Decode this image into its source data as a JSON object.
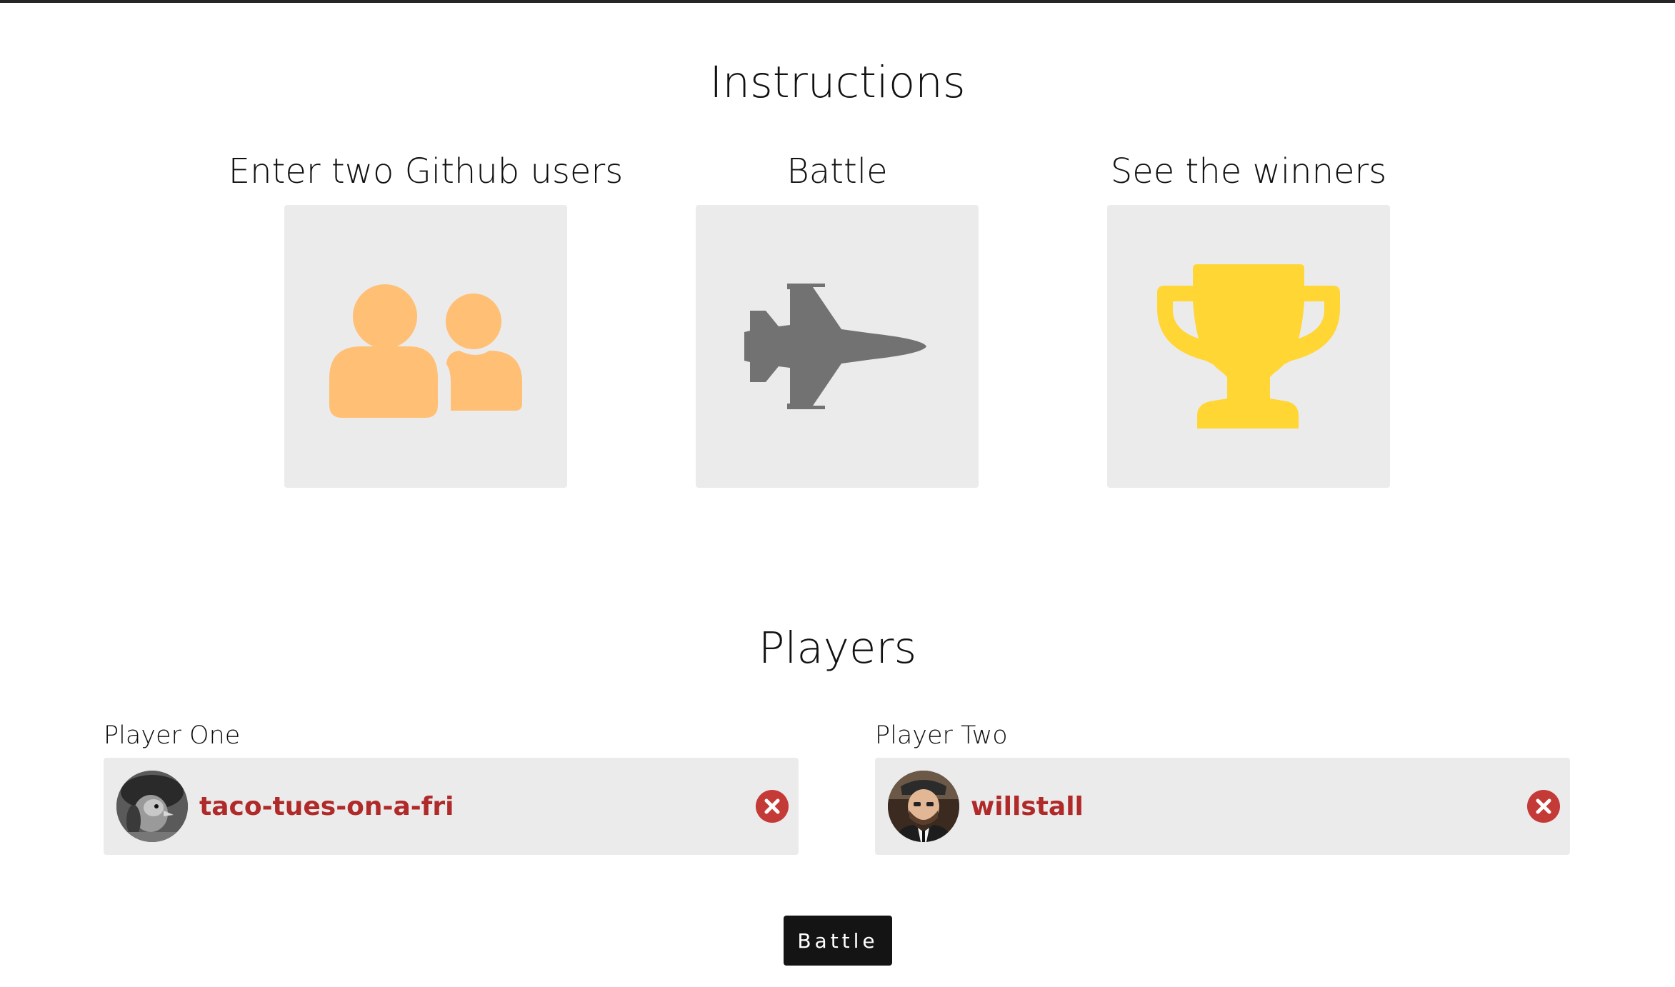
{
  "instructions": {
    "title": "Instructions",
    "steps": [
      {
        "label": "Enter two Github users",
        "icon": "users-icon",
        "color": "#ffbf74"
      },
      {
        "label": "Battle",
        "icon": "fighter-jet-icon",
        "color": "#727272"
      },
      {
        "label": "See the winners",
        "icon": "trophy-icon",
        "color": "#ffd633"
      }
    ]
  },
  "players": {
    "title": "Players",
    "one": {
      "label": "Player One",
      "username": "taco-tues-on-a-fri"
    },
    "two": {
      "label": "Player Two",
      "username": "willstall"
    }
  },
  "battle_button": {
    "label": "Battle"
  },
  "colors": {
    "username": "#b02a2a",
    "remove": "#c43a36",
    "card_bg": "#ebebeb",
    "button_bg": "#141414"
  }
}
